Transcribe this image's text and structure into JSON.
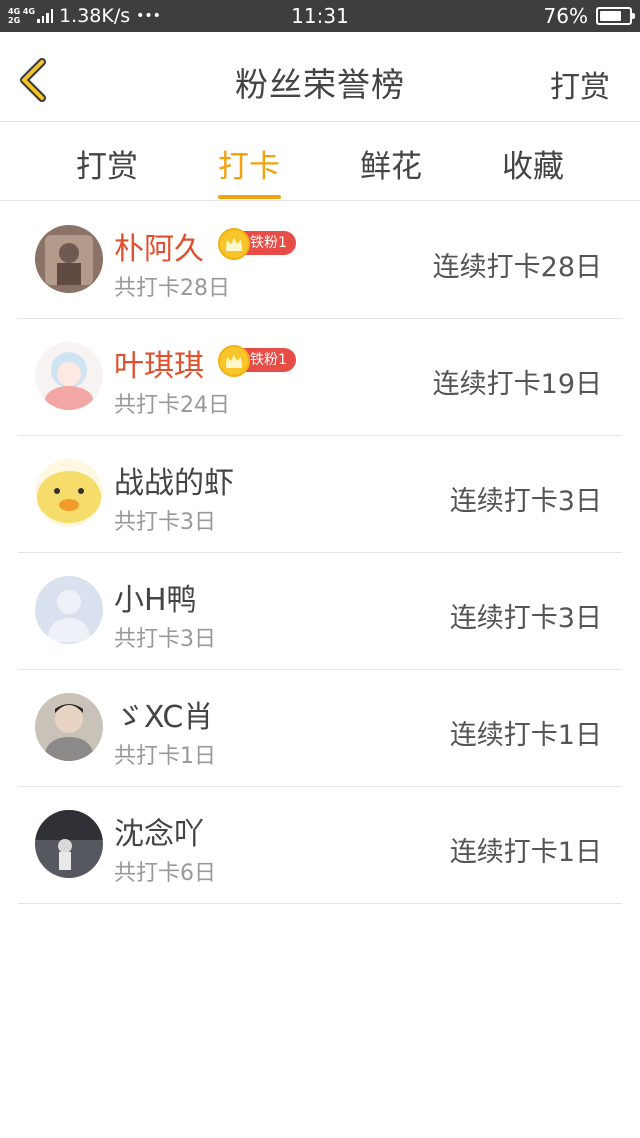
{
  "status_bar": {
    "network_top": "4G 4G",
    "network_bottom": "2G",
    "speed": "1.38K/s",
    "dots": "•••",
    "time": "11:31",
    "battery_percent": "76%",
    "battery_level": 0.76
  },
  "header": {
    "title": "粉丝荣誉榜",
    "action_label": "打赏",
    "back_icon": "chevron-left-icon"
  },
  "tabs": [
    {
      "label": "打赏",
      "active": false
    },
    {
      "label": "打卡",
      "active": true
    },
    {
      "label": "鲜花",
      "active": false
    },
    {
      "label": "收藏",
      "active": false
    }
  ],
  "colors": {
    "accent": "#f3a10c",
    "top_name": "#e24f2c",
    "badge": "#e84c47"
  },
  "rows": [
    {
      "name": "朴阿久",
      "badge": "铁粉1",
      "total": "共打卡28日",
      "streak": "连续打卡28日",
      "highlight": true
    },
    {
      "name": "叶琪琪",
      "badge": "铁粉1",
      "total": "共打卡24日",
      "streak": "连续打卡19日",
      "highlight": true
    },
    {
      "name": "战战的虾",
      "badge": "",
      "total": "共打卡3日",
      "streak": "连续打卡3日",
      "highlight": false
    },
    {
      "name": "小H鸭",
      "badge": "",
      "total": "共打卡3日",
      "streak": "连续打卡3日",
      "highlight": false
    },
    {
      "name": "ゞXC肖",
      "badge": "",
      "total": "共打卡1日",
      "streak": "连续打卡1日",
      "highlight": false
    },
    {
      "name": "沈念吖",
      "badge": "",
      "total": "共打卡6日",
      "streak": "连续打卡1日",
      "highlight": false
    }
  ]
}
